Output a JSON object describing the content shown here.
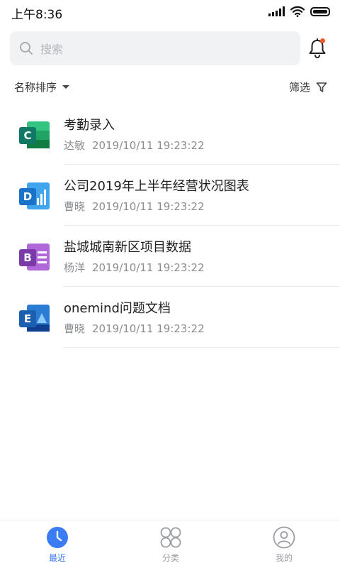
{
  "status_bar": {
    "time": "上午8:36",
    "icons": [
      "signal-icon",
      "wifi-icon",
      "battery-icon"
    ]
  },
  "search": {
    "placeholder": "搜索",
    "icon": "search-icon"
  },
  "notification": {
    "icon": "bell-icon",
    "has_unread": true,
    "dot_color": "#f2592f"
  },
  "toolbar": {
    "sort_label": "名称排序",
    "filter_label": "筛选"
  },
  "files": [
    {
      "title": "考勤录入",
      "author": "达敏",
      "date": "2019/10/11 19:23:22",
      "icon_letter": "C",
      "icon_color": "#117865"
    },
    {
      "title": "公司2019年上半年经营状况图表",
      "author": "曹晓",
      "date": "2019/10/11 19:23:22",
      "icon_letter": "D",
      "icon_color": "#1a73c9"
    },
    {
      "title": "盐城城南新区项目数据",
      "author": "杨洋",
      "date": "2019/10/11 19:23:22",
      "icon_letter": "B",
      "icon_color": "#7a3aa8"
    },
    {
      "title": "onemind问题文档",
      "author": "曹晓",
      "date": "2019/10/11 19:23:22",
      "icon_letter": "E",
      "icon_color": "#1a5fb0"
    }
  ],
  "bottom_nav": [
    {
      "label": "最近",
      "icon": "clock-icon",
      "active": true
    },
    {
      "label": "分类",
      "icon": "category-icon",
      "active": false
    },
    {
      "label": "我的",
      "icon": "profile-icon",
      "active": false
    }
  ],
  "colors": {
    "accent": "#3b7cf5",
    "text_primary": "#1e1e1e",
    "text_secondary": "#8a8d92"
  }
}
